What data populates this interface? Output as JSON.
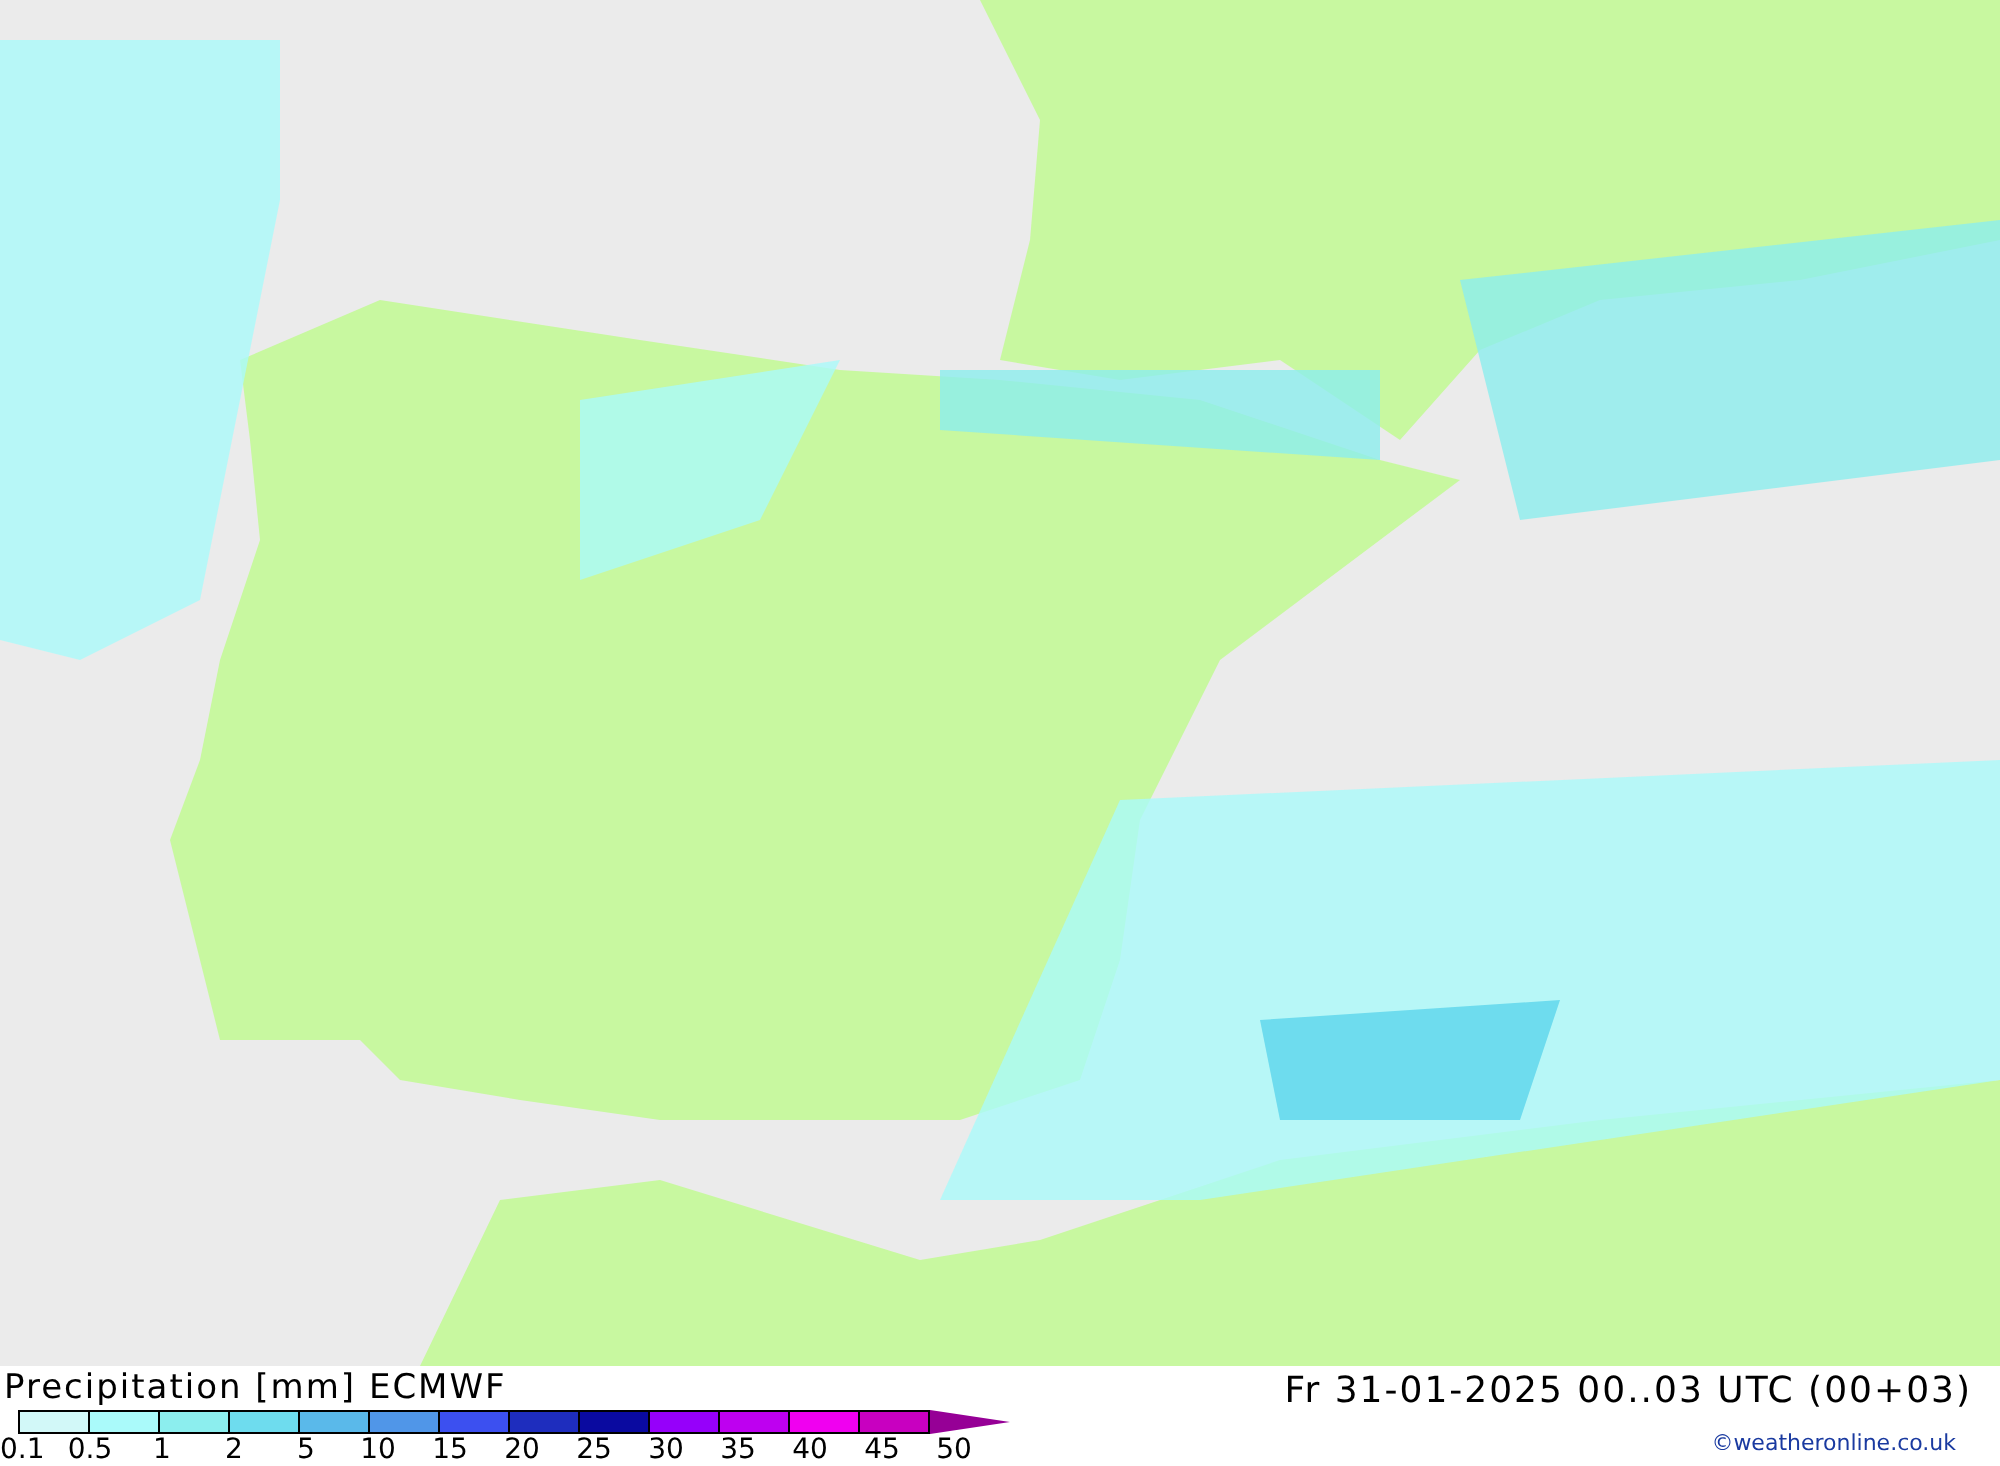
{
  "title": "Precipitation [mm] ECMWF",
  "valid_time": "Fr 31-01-2025 00..03 UTC (00+03)",
  "credit": "©weatheronline.co.uk",
  "legend": [
    {
      "label": "0.1",
      "color": "#d2f8f8"
    },
    {
      "label": "0.5",
      "color": "#aafafa"
    },
    {
      "label": "1",
      "color": "#8ceeee"
    },
    {
      "label": "2",
      "color": "#6edcee"
    },
    {
      "label": "5",
      "color": "#5ab9ea"
    },
    {
      "label": "10",
      "color": "#5096e8"
    },
    {
      "label": "15",
      "color": "#3c50f0"
    },
    {
      "label": "20",
      "color": "#1e2dbe"
    },
    {
      "label": "25",
      "color": "#0a0aa0"
    },
    {
      "label": "30",
      "color": "#9600fa"
    },
    {
      "label": "35",
      "color": "#be00f0"
    },
    {
      "label": "40",
      "color": "#f000f0"
    },
    {
      "label": "45",
      "color": "#c800c0"
    },
    {
      "label": "50",
      "color": "#960096"
    }
  ]
}
